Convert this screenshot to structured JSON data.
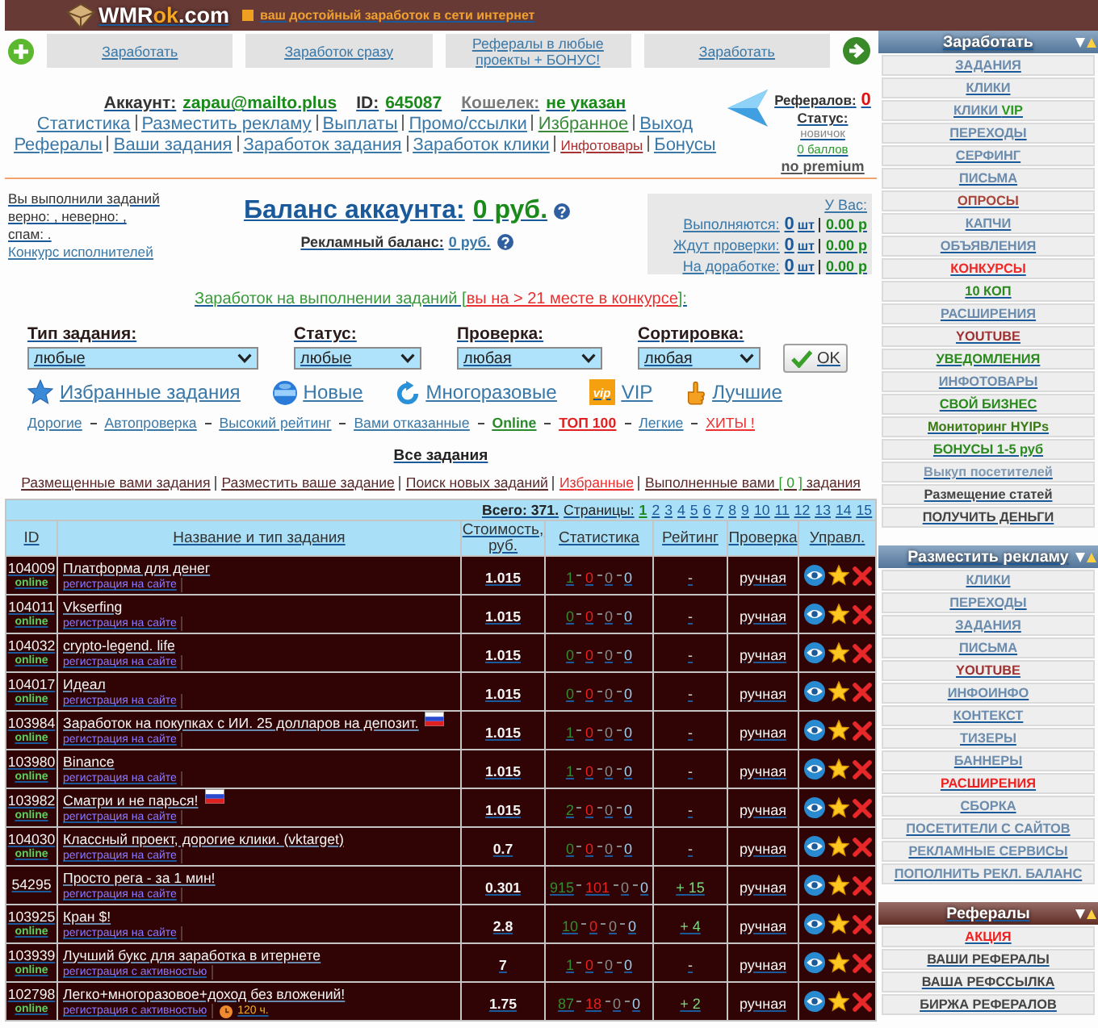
{
  "header": {
    "logo": [
      {
        "text": "WMR",
        "accent": false
      },
      {
        "text": "ok",
        "accent": true
      },
      {
        "text": ".com",
        "accent": false
      }
    ],
    "tagline": "ваш достойный заработок в сети интернет"
  },
  "promo_links": [
    "Заработать",
    "Заработок сразу",
    "Рефералы в любые проекты + БОНУС!",
    "Заработать"
  ],
  "account": {
    "fields": [
      {
        "label": "Аккаунт:",
        "value": "zapau@mailto.plus",
        "muted": false
      },
      {
        "label": "ID:",
        "value": "645087",
        "muted": false
      },
      {
        "label": "Кошелек:",
        "value": "не указан",
        "muted": true
      }
    ],
    "nav_rows": [
      [
        {
          "label": "Статистика",
          "kind": "normal",
          "color": "#3a78a8"
        },
        {
          "label": "Разместить рекламу",
          "kind": "normal",
          "color": "#3a78a8"
        },
        {
          "label": "Выплаты",
          "kind": "normal",
          "color": "#3a78a8"
        },
        {
          "label": "Промо/ссылки",
          "kind": "normal",
          "color": "#3a78a8"
        },
        {
          "label": "Избранное",
          "kind": "normal",
          "color": "#3a8a3a"
        },
        {
          "label": "Выход",
          "kind": "normal",
          "color": "#3a78a8"
        }
      ],
      [
        {
          "label": "Рефералы",
          "kind": "normal",
          "color": "#3a78a8"
        },
        {
          "label": "Ваши задания",
          "kind": "normal",
          "color": "#3a78a8"
        },
        {
          "label": "Заработок задания",
          "kind": "normal",
          "color": "#3a78a8"
        },
        {
          "label": "Заработок клики",
          "kind": "normal",
          "color": "#3a78a8"
        },
        {
          "label": "Инфотовары",
          "kind": "small",
          "color": "#a83232"
        },
        {
          "label": "Бонусы",
          "kind": "normal",
          "color": "#3a78a8"
        }
      ]
    ],
    "panel": {
      "referrals_label": "Рефералов:",
      "referrals_count": "0",
      "status_label": "Статус:",
      "rank": "новичок",
      "points": "0 баллов",
      "premium": "no premium"
    }
  },
  "summary": {
    "lines": [
      "Вы выполнили заданий",
      "верно: , неверно: ,",
      "спам: ."
    ],
    "contest_link": "Конкурс исполнителей"
  },
  "balance": {
    "label": "Баланс аккаунта:",
    "value": "0 руб.",
    "ad_label": "Рекламный баланс:",
    "ad_value": "0 руб."
  },
  "counters": {
    "title": "У Вас:",
    "rows": [
      {
        "label": "Выполняются:",
        "count": "0",
        "unit": "шт",
        "amount": "0.00 р"
      },
      {
        "label": "Ждут проверки:",
        "count": "0",
        "unit": "шт",
        "amount": "0.00 р"
      },
      {
        "label": "На доработке:",
        "count": "0",
        "unit": "шт",
        "amount": "0.00 р"
      }
    ]
  },
  "earnings_note": {
    "text": "Заработок на выполнении заданий [",
    "link": "вы на > 21 месте в конкурсе",
    "text_after": "]:"
  },
  "filters": [
    {
      "label": "Тип задания:",
      "value": "любые"
    },
    {
      "label": "Статус:",
      "value": "любые"
    },
    {
      "label": "Проверка:",
      "value": "любая"
    },
    {
      "label": "Сортировка:",
      "value": "любая"
    }
  ],
  "ok_button": "OK",
  "quick_links": [
    {
      "kind": "star",
      "label": "Избранные задания"
    },
    {
      "kind": "new",
      "label": "Новые"
    },
    {
      "kind": "refresh",
      "label": "Многоразовые"
    },
    {
      "kind": "vip",
      "label": "VIP",
      "badge": "vip"
    },
    {
      "kind": "hand",
      "label": "Лучшие"
    }
  ],
  "filter_links": [
    {
      "label": "Дорогие",
      "color": "#3a78a8",
      "bold": false
    },
    {
      "label": "Автопроверка",
      "color": "#3a78a8",
      "bold": false
    },
    {
      "label": "Высокий рейтинг",
      "color": "#3a78a8",
      "bold": false
    },
    {
      "label": "Вами отказанные",
      "color": "#3a78a8",
      "bold": false
    },
    {
      "label": "Online",
      "color": "#2a8a2a",
      "bold": true
    },
    {
      "label": "ТОП 100",
      "color": "#e02020",
      "bold": true
    },
    {
      "label": "Легкие",
      "color": "#3a78a8",
      "bold": false
    },
    {
      "label": "ХИТЫ !",
      "color": "#f03030",
      "bold": false
    }
  ],
  "section_title": "Все задания",
  "task_links": [
    {
      "label": "Размещенные вами задания",
      "color": "#5a2a2a"
    },
    {
      "label": "Разместить ваше задание",
      "color": "#5a2a2a"
    },
    {
      "label": "Поиск новых заданий",
      "color": "#5a2a2a"
    },
    {
      "label": "Избранные",
      "color": "#e83030"
    },
    {
      "label": "Выполненные вами",
      "count": "[ 0 ]",
      "suffix": "задания",
      "color": "#5a2a2a"
    }
  ],
  "table": {
    "total": "Всего: 371.",
    "pages_label": "Страницы:",
    "pages": [
      {
        "label": "1",
        "selected": true
      },
      {
        "label": "2",
        "selected": false
      },
      {
        "label": "3",
        "selected": false
      },
      {
        "label": "4",
        "selected": false
      },
      {
        "label": "5",
        "selected": false
      },
      {
        "label": "6",
        "selected": false
      },
      {
        "label": "7",
        "selected": false
      },
      {
        "label": "8",
        "selected": false
      },
      {
        "label": "9",
        "selected": false
      },
      {
        "label": "10",
        "selected": false
      },
      {
        "label": "11",
        "selected": false
      },
      {
        "label": "12",
        "selected": false
      },
      {
        "label": "13",
        "selected": false
      },
      {
        "label": "14",
        "selected": false
      },
      {
        "label": "15",
        "selected": false
      }
    ],
    "columns": [
      "ID",
      "Название и тип задания",
      "Стоимость, руб.",
      "Статистика",
      "Рейтинг",
      "Проверка",
      "Управл."
    ],
    "rows": [
      {
        "id": "104009",
        "status": "online",
        "title": "Платформа для денег",
        "flag": false,
        "type": "регистрация на сайте",
        "price": "1.015",
        "stats": [
          "1",
          "0",
          "0",
          "0"
        ],
        "rating": "-",
        "rating_positive": false,
        "check": "ручная"
      },
      {
        "id": "104011",
        "status": "online",
        "title": "Vkserfing",
        "flag": false,
        "type": "регистрация на сайте",
        "price": "1.015",
        "stats": [
          "0",
          "0",
          "0",
          "0"
        ],
        "rating": "-",
        "rating_positive": false,
        "check": "ручная"
      },
      {
        "id": "104032",
        "status": "online",
        "title": "crypto-legend. life",
        "flag": false,
        "type": "регистрация на сайте",
        "price": "1.015",
        "stats": [
          "0",
          "0",
          "0",
          "0"
        ],
        "rating": "-",
        "rating_positive": false,
        "check": "ручная"
      },
      {
        "id": "104017",
        "status": "online",
        "title": "Идеал",
        "flag": false,
        "type": "регистрация на сайте",
        "price": "1.015",
        "stats": [
          "0",
          "0",
          "0",
          "0"
        ],
        "rating": "-",
        "rating_positive": false,
        "check": "ручная"
      },
      {
        "id": "103984",
        "status": "online",
        "title": "Заработок на покупках с ИИ. 25 долларов на депозит.",
        "flag": true,
        "type": "регистрация на сайте",
        "price": "1.015",
        "stats": [
          "1",
          "0",
          "0",
          "0"
        ],
        "rating": "-",
        "rating_positive": false,
        "check": "ручная"
      },
      {
        "id": "103980",
        "status": "online",
        "title": "Binance",
        "flag": false,
        "type": "регистрация на сайте",
        "price": "1.015",
        "stats": [
          "1",
          "0",
          "0",
          "0"
        ],
        "rating": "-",
        "rating_positive": false,
        "check": "ручная"
      },
      {
        "id": "103982",
        "status": "online",
        "title": "Сматри и не парься!",
        "flag": true,
        "type": "регистрация на сайте",
        "price": "1.015",
        "stats": [
          "2",
          "0",
          "0",
          "0"
        ],
        "rating": "-",
        "rating_positive": false,
        "check": "ручная"
      },
      {
        "id": "104030",
        "status": "online",
        "title": "Классный проект, дорогие клики. (vktarget)",
        "flag": false,
        "type": "регистрация на сайте",
        "price": "0.7",
        "stats": [
          "0",
          "0",
          "0",
          "0"
        ],
        "rating": "-",
        "rating_positive": false,
        "check": "ручная"
      },
      {
        "id": "54295",
        "title": "Просто рега - за 1 мин!",
        "flag": false,
        "type": "регистрация на сайте",
        "price": "0.301",
        "stats": [
          "915",
          "101",
          "0",
          "0"
        ],
        "rating": "+ 15",
        "rating_positive": true,
        "check": "ручная"
      },
      {
        "id": "103925",
        "status": "online",
        "title": "Кран $!",
        "flag": false,
        "type": "регистрация на сайте",
        "price": "2.8",
        "stats": [
          "10",
          "0",
          "0",
          "0"
        ],
        "rating": "+ 4",
        "rating_positive": true,
        "check": "ручная"
      },
      {
        "id": "103939",
        "status": "online",
        "title": "Лучший букс для заработка в итернете",
        "flag": false,
        "type": "регистрация с активностью",
        "price": "7",
        "stats": [
          "1",
          "0",
          "0",
          "0"
        ],
        "rating": "-",
        "rating_positive": false,
        "check": "ручная"
      },
      {
        "id": "102798",
        "status": "online",
        "title": "Легко+многоразовое+доход без вложений!",
        "flag": false,
        "type": "регистрация с активностью",
        "timer": "120 ч.",
        "price": "1.75",
        "stats": [
          "87",
          "18",
          "0",
          "0"
        ],
        "rating": "+ 2",
        "rating_positive": true,
        "check": "ручная"
      }
    ]
  },
  "sidebar": [
    {
      "title": "Заработать",
      "color": "#5f86ae",
      "items": [
        {
          "label": "ЗАДАНИЯ",
          "color": "#6b8cad"
        },
        {
          "label": "КЛИКИ",
          "color": "#6b8cad"
        },
        {
          "label": "КЛИКИ",
          "suffix": "VIP",
          "color": "#6b8cad"
        },
        {
          "label": "ПЕРЕХОДЫ",
          "color": "#6b8cad"
        },
        {
          "label": "СЕРФИНГ",
          "color": "#6b8cad"
        },
        {
          "label": "ПИСЬМА",
          "color": "#6b8cad"
        },
        {
          "label": "ОПРОСЫ",
          "color": "#a8453a"
        },
        {
          "label": "КАПЧИ",
          "color": "#6b8cad"
        },
        {
          "label": "ОБЪЯВЛЕНИЯ",
          "color": "#6b8cad"
        },
        {
          "label": "КОНКУРСЫ",
          "color": "#f02828"
        },
        {
          "label": "10 КОП",
          "color": "#2a8a1e"
        },
        {
          "label": "РАСШИРЕНИЯ",
          "color": "#6b8cad"
        },
        {
          "label": "YOUTUBE",
          "color": "#9e3232"
        },
        {
          "label": "УВЕДОМЛЕНИЯ",
          "color": "#2a8a1e"
        },
        {
          "label": "ИНФОТОВАРЫ",
          "color": "#6b8cad"
        },
        {
          "label": "СВОЙ БИЗНЕС",
          "color": "#2a8a1e"
        },
        {
          "label": "Мониторинг HYIPs",
          "color": "#3a7a14"
        },
        {
          "label": "БОНУСЫ 1-5 руб",
          "color": "#2a8a1e"
        },
        {
          "label": "Выкуп посетителей",
          "color": "#7f97b0"
        },
        {
          "label": "Размещение статей",
          "color": "#444444"
        },
        {
          "label": "ПОЛУЧИТЬ ДЕНЬГИ",
          "color": "#444444"
        }
      ]
    },
    {
      "title": "Разместить рекламу",
      "color": "#5f86ae",
      "items": [
        {
          "label": "КЛИКИ",
          "color": "#6b8cad"
        },
        {
          "label": "ПЕРЕХОДЫ",
          "color": "#6b8cad"
        },
        {
          "label": "ЗАДАНИЯ",
          "color": "#6b8cad"
        },
        {
          "label": "ПИСЬМА",
          "color": "#6b8cad"
        },
        {
          "label": "YOUTUBE",
          "color": "#9e3232"
        },
        {
          "label": "ИНФОИНФО",
          "color": "#6b8cad"
        },
        {
          "label": "КОНТЕКСТ",
          "color": "#6b8cad"
        },
        {
          "label": "ТИЗЕРЫ",
          "color": "#6b8cad"
        },
        {
          "label": "БАННЕРЫ",
          "color": "#6b8cad"
        },
        {
          "label": "РАСШИРЕНИЯ",
          "color": "#f02020"
        },
        {
          "label": "СБОРКА",
          "color": "#6b8cad"
        },
        {
          "label": "ПОСЕТИТЕЛИ С САЙТОВ",
          "color": "#6b8cad"
        },
        {
          "label": "РЕКЛАМНЫЕ СЕРВИСЫ",
          "color": "#6b8cad"
        },
        {
          "label": "ПОПОЛНИТЬ РЕКЛ. БАЛАНС",
          "color": "#6b8cad"
        }
      ]
    },
    {
      "title": "Рефералы",
      "color": "#6e342c",
      "items": [
        {
          "label": "АКЦИЯ",
          "color": "#f02020"
        },
        {
          "label": "ВАШИ РЕФЕРАЛЫ",
          "color": "#444444"
        },
        {
          "label": "ВАША РЕФССЫЛКА",
          "color": "#444444"
        },
        {
          "label": "БИРЖА РЕФЕРАЛОВ",
          "color": "#444444"
        }
      ]
    }
  ]
}
